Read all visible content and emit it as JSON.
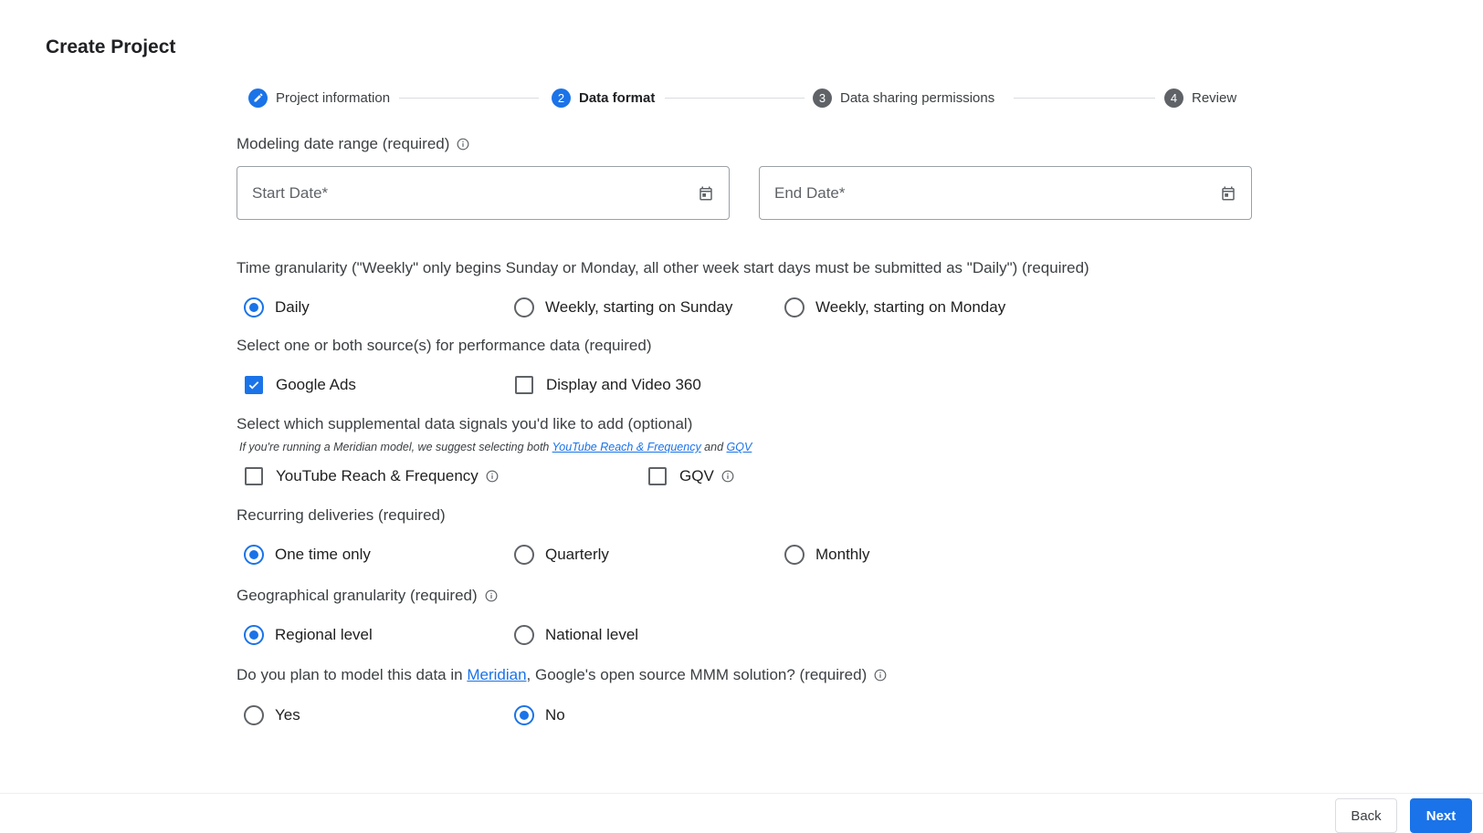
{
  "page": {
    "title": "Create Project"
  },
  "stepper": {
    "steps": [
      {
        "number": "",
        "label": "Project information",
        "state": "completed"
      },
      {
        "number": "2",
        "label": "Data format",
        "state": "current"
      },
      {
        "number": "3",
        "label": "Data sharing permissions",
        "state": "upcoming"
      },
      {
        "number": "4",
        "label": "Review",
        "state": "upcoming"
      }
    ]
  },
  "date_range": {
    "label": "Modeling date range (required)",
    "start": {
      "placeholder": "Start Date*",
      "value": ""
    },
    "end": {
      "placeholder": "End Date*",
      "value": ""
    }
  },
  "time_granularity": {
    "label": "Time granularity (\"Weekly\" only begins Sunday or Monday, all other week start days must be submitted as \"Daily\") (required)",
    "options": [
      {
        "label": "Daily",
        "selected": true
      },
      {
        "label": "Weekly, starting on Sunday",
        "selected": false
      },
      {
        "label": "Weekly, starting on Monday",
        "selected": false
      }
    ]
  },
  "performance_sources": {
    "label": "Select one or both source(s) for performance data (required)",
    "options": [
      {
        "label": "Google Ads",
        "checked": true
      },
      {
        "label": "Display and Video 360",
        "checked": false
      }
    ]
  },
  "supplemental_signals": {
    "label": "Select which supplemental data signals you'd like to add (optional)",
    "hint_prefix": "If you're running a Meridian model, we suggest selecting both ",
    "hint_link1": "YouTube Reach & Frequency",
    "hint_mid": " and ",
    "hint_link2": "GQV",
    "options": [
      {
        "label": "YouTube Reach & Frequency",
        "checked": false
      },
      {
        "label": "GQV",
        "checked": false
      }
    ]
  },
  "recurring_deliveries": {
    "label": "Recurring deliveries (required)",
    "options": [
      {
        "label": "One time only",
        "selected": true
      },
      {
        "label": "Quarterly",
        "selected": false
      },
      {
        "label": "Monthly",
        "selected": false
      }
    ]
  },
  "geo_granularity": {
    "label": "Geographical granularity (required)",
    "options": [
      {
        "label": "Regional level",
        "selected": true
      },
      {
        "label": "National level",
        "selected": false
      }
    ]
  },
  "meridian": {
    "label_prefix": "Do you plan to model this data in ",
    "label_link": "Meridian",
    "label_suffix": ", Google's open source MMM solution? (required)",
    "options": [
      {
        "label": "Yes",
        "selected": false
      },
      {
        "label": "No",
        "selected": true
      }
    ]
  },
  "footer": {
    "back_label": "Back",
    "next_label": "Next"
  },
  "colors": {
    "accent": "#1a73e8",
    "step_inactive": "#5f6368",
    "text": "#1f1f1f"
  }
}
